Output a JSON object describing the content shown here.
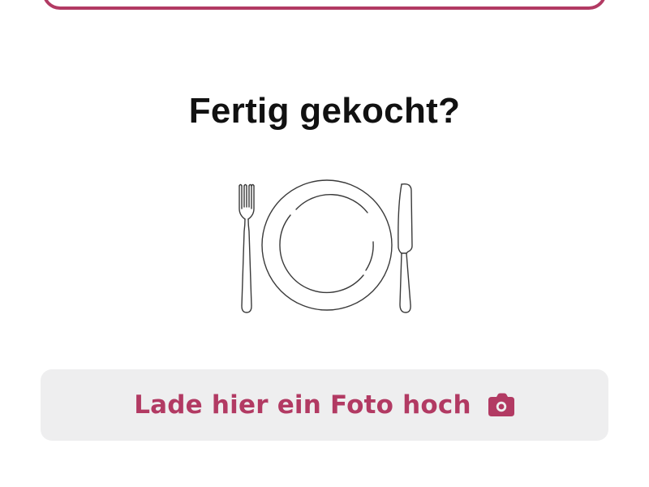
{
  "header": {
    "title": "Fertig gekocht?"
  },
  "illustration": {
    "icon": "plate-fork-knife-icon"
  },
  "upload": {
    "label": "Lade hier ein Foto hoch",
    "icon": "camera-icon",
    "color": "#b23a63",
    "background": "#eeeeef"
  },
  "colors": {
    "accent": "#b23a63",
    "text": "#111111",
    "line": "#3a3a3a"
  }
}
